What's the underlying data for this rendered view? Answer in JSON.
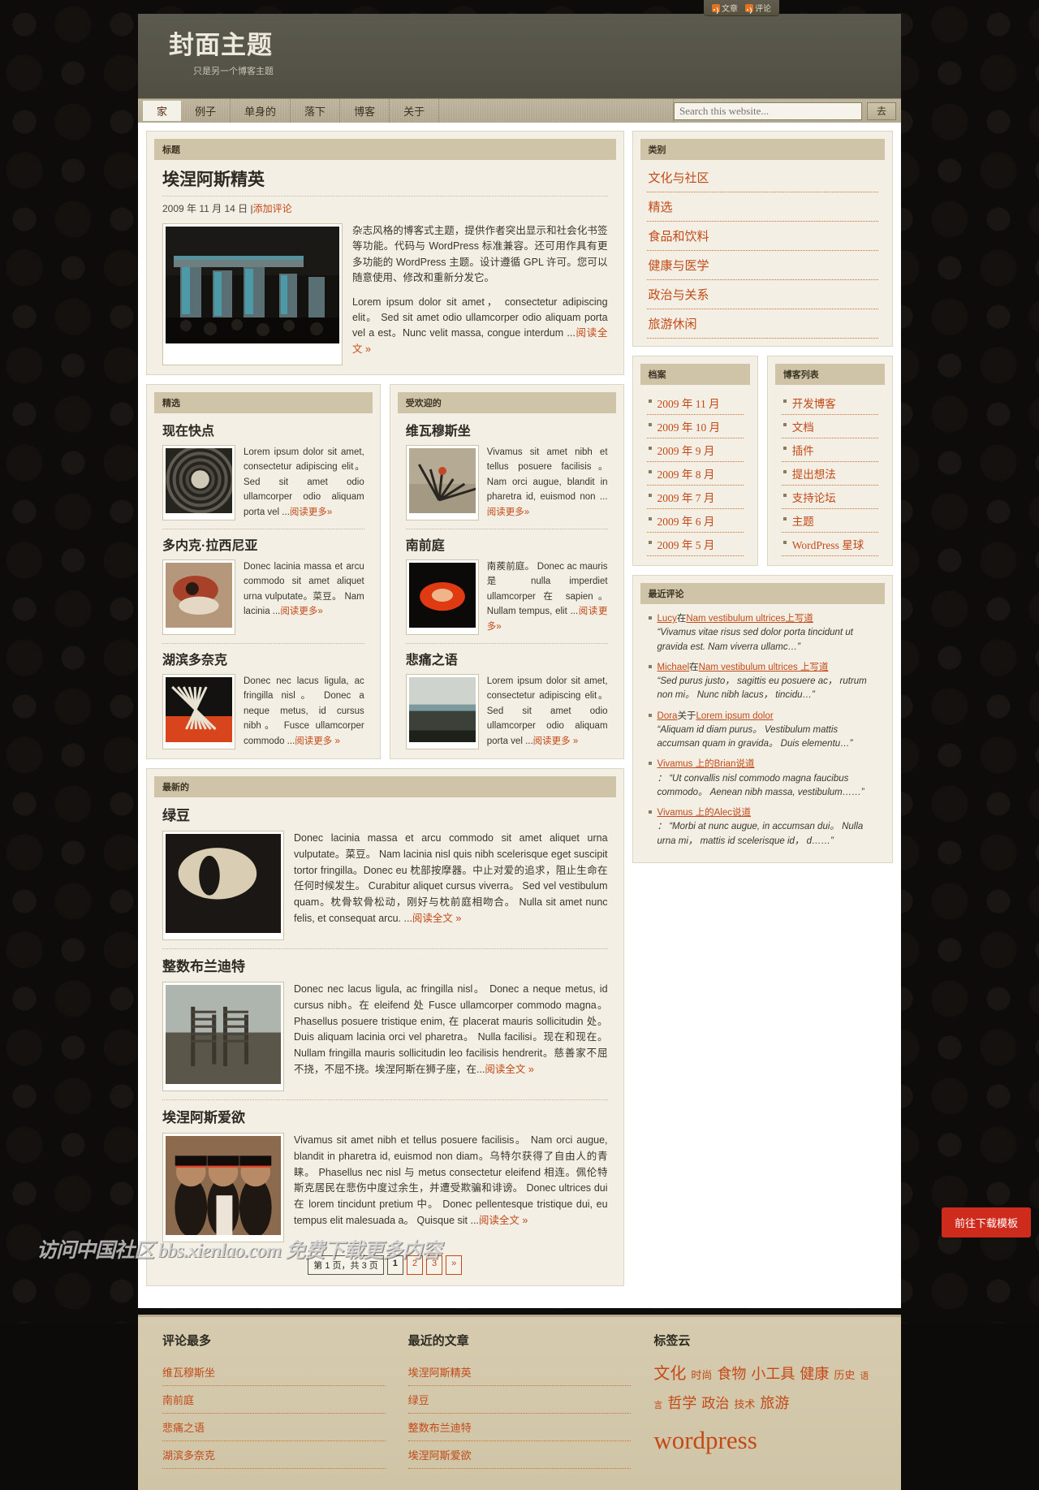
{
  "topbar": {
    "posts_label": "文章",
    "comments_label": "评论"
  },
  "header": {
    "title": "封面主题",
    "description": "只是另一个博客主题"
  },
  "nav": {
    "items": [
      {
        "label": "家",
        "current": true
      },
      {
        "label": "例子",
        "current": false
      },
      {
        "label": "单身的",
        "current": false
      },
      {
        "label": "落下",
        "current": false
      },
      {
        "label": "博客",
        "current": false
      },
      {
        "label": "关于",
        "current": false
      }
    ],
    "search_placeholder": "Search this website...",
    "search_value": "",
    "search_button": "去"
  },
  "featured": {
    "panel_title": "标题",
    "post_title": "埃涅阿斯精英",
    "date": "2009 年 11 月 14 日",
    "separator": "|",
    "comment_link": "添加评论",
    "para1": "杂志风格的博客式主题，提供作者突出显示和社会化书签等功能。代码与 WordPress 标准兼容。还可用作具有更多功能的 WordPress 主题。设计遵循 GPL 许可。您可以随意使用、修改和重新分发它。",
    "para2": "Lorem ipsum dolor sit amet， consectetur adipiscing elit。 Sed sit amet odio ullamcorper odio aliquam porta vel a est。Nunc velit massa, congue interdum ...",
    "read_more": "阅读全文 »"
  },
  "featured_column": {
    "panel_title": "精选",
    "posts": [
      {
        "title": "现在快点",
        "excerpt": "Lorem ipsum dolor sit amet, consectetur adipiscing elit。 Sed sit amet odio ullamcorper odio aliquam porta vel ...",
        "read_more": "阅读更多»"
      },
      {
        "title": "多内克·拉西尼亚",
        "excerpt": "Donec lacinia massa et arcu commodo sit amet aliquet urna vulputate。菜豆。 Nam lacinia ...",
        "read_more": "阅读更多»"
      },
      {
        "title": "湖滨多奈克",
        "excerpt": "Donec nec lacus ligula, ac fringilla nisl。 Donec a neque metus, id cursus nibh。 Fusce ullamcorper commodo ...",
        "read_more": "阅读更多 »"
      }
    ]
  },
  "popular_column": {
    "panel_title": "受欢迎的",
    "posts": [
      {
        "title": "维瓦穆斯坐",
        "excerpt": "Vivamus sit amet nibh et tellus posuere facilisis。 Nam orci augue, blandit in pharetra id, euismod non ...",
        "read_more": "阅读更多»"
      },
      {
        "title": "南前庭",
        "excerpt": "南蒺前庭。 Donec ac mauris 是 nulla imperdiet ullamcorper 在 sapien。 Nullam tempus, elit ...",
        "read_more": "阅读更多»"
      },
      {
        "title": "悲痛之语",
        "excerpt": "Lorem ipsum dolor sit amet, consectetur adipiscing elit。 Sed sit amet odio ullamcorper odio aliquam porta vel ...",
        "read_more": "阅读更多 »"
      }
    ]
  },
  "latest": {
    "panel_title": "最新的",
    "posts": [
      {
        "title": "绿豆",
        "excerpt": "Donec lacinia massa et arcu commodo sit amet aliquet urna vulputate。菜豆。 Nam lacinia nisl quis nibh scelerisque eget suscipit tortor fringilla。Donec eu 枕部按摩器。中止对爱的追求，阻止生命在任何时候发生。 Curabitur aliquet cursus viverra。 Sed vel vestibulum quam。枕骨软骨松动，刚好与枕前庭相吻合。 Nulla sit amet nunc felis, et consequat arcu. ...",
        "read_more": "阅读全文 »"
      },
      {
        "title": "整数布兰迪特",
        "excerpt": "Donec nec lacus ligula, ac fringilla nisl。 Donec a neque metus, id cursus nibh。在 eleifend 处 Fusce ullamcorper commodo magna。 Phasellus posuere tristique enim, 在 placerat mauris sollicitudin 处。 Duis aliquam lacinia orci vel pharetra。 Nulla facilisi。现在和现在。 Nullam fringilla mauris sollicitudin leo facilisis hendrerit。慈善家不屈不挠，不屈不挠。埃涅阿斯在狮子座，在...",
        "read_more": "阅读全文 »"
      },
      {
        "title": "埃涅阿斯爱欲",
        "excerpt": "Vivamus sit amet nibh et tellus posuere facilisis。 Nam orci augue, blandit in pharetra id, euismod non diam。乌特尔获得了自由人的青睐。 Phasellus nec nisl 与 metus consectetur eleifend 相连。佩伦特斯克居民在悲伤中度过余生，并遭受欺骗和诽谤。 Donec ultrices dui 在 lorem tincidunt pretium 中。 Donec pellentesque tristique dui, eu tempus elit malesuada a。 Quisque sit ...",
        "read_more": "阅读全文 »"
      }
    ]
  },
  "pagination": {
    "info": "第 1 页，共 3 页",
    "pages": [
      "1",
      "2",
      "3"
    ],
    "next": "»",
    "current": "1"
  },
  "sidebar": {
    "categories": {
      "title": "类别",
      "items": [
        "文化与社区",
        "精选",
        "食品和饮料",
        "健康与医学",
        "政治与关系",
        "旅游休闲"
      ]
    },
    "archives": {
      "title": "档案",
      "items": [
        "2009 年 11 月",
        "2009 年 10 月",
        "2009 年 9 月",
        "2009 年 8 月",
        "2009 年 7 月",
        "2009 年 6 月",
        "2009 年 5 月"
      ]
    },
    "blogroll": {
      "title": "博客列表",
      "items": [
        "开发博客",
        "文档",
        "插件",
        "提出想法",
        "支持论坛",
        "主题",
        "WordPress 星球"
      ]
    },
    "recent_comments": {
      "title": "最近评论",
      "items": [
        {
          "author": "Lucy",
          "connector": "在",
          "post": "Nam vestibulum ultrices",
          "suffix": "上写道",
          "quote": "“Vivamus vitae risus sed dolor porta tincidunt ut gravida est. Nam viverra ullamc…”"
        },
        {
          "author": "Michael",
          "connector": "在",
          "post": "Nam vestibulum ultrices",
          "suffix": " 上写道",
          "quote": "“Sed purus justo， sagittis eu posuere ac， rutrum non mi。 Nunc nibh lacus， tincidu…”"
        },
        {
          "author": "Dora",
          "connector": "关于",
          "post": "Lorem ipsum dolor",
          "suffix": "",
          "quote": "“Aliquam id diam purus。 Vestibulum mattis accumsan quam in gravida。 Duis elementu…”"
        },
        {
          "author": "Vivamus 上的",
          "connector": "",
          "post": "Brian说道",
          "suffix": "",
          "quote": "： “Ut convallis nisl commodo magna faucibus commodo。 Aenean nibh massa, vestibulum……”"
        },
        {
          "author": "Vivamus 上的",
          "connector": "",
          "post": "Alec说道",
          "suffix": "",
          "quote": "： “Morbi at nunc augue, in accumsan dui。 Nulla urna mi， mattis id scelerisque id， d……”"
        }
      ]
    }
  },
  "footer": {
    "most_commented": {
      "title": "评论最多",
      "items": [
        "维瓦穆斯坐",
        "南前庭",
        "悲痛之语",
        "湖滨多奈克"
      ]
    },
    "recent_posts": {
      "title": "最近的文章",
      "items": [
        "埃涅阿斯精英",
        "绿豆",
        "整数布兰迪特",
        "埃涅阿斯爱欲"
      ]
    },
    "tag_cloud": {
      "title": "标签云",
      "tags": [
        {
          "label": "文化",
          "size": 20
        },
        {
          "label": "时尚",
          "size": 13
        },
        {
          "label": "食物",
          "size": 18
        },
        {
          "label": "小工具",
          "size": 18
        },
        {
          "label": "健康",
          "size": 18
        },
        {
          "label": "历史",
          "size": 13
        },
        {
          "label": "语言",
          "size": 11
        },
        {
          "label": "哲学",
          "size": 18
        },
        {
          "label": "政治",
          "size": 17
        },
        {
          "label": "技术",
          "size": 13
        },
        {
          "label": "旅游",
          "size": 18
        },
        {
          "label": "wordpress",
          "size": 31
        }
      ]
    }
  },
  "overlay": {
    "watermark": "访问中国社区 bbs.xienlao.com 免费下载更多内容",
    "download_button": "前往下载模板"
  },
  "colors": {
    "accent": "#c34a18",
    "header_bg": "#57554a",
    "nav_bg": "#b7ad94",
    "panel_bg": "#f3efe4",
    "panel_title_bg": "#cfc4a8",
    "footer_bg": "#d3c8ab",
    "download_btn": "#cf2b1d"
  }
}
